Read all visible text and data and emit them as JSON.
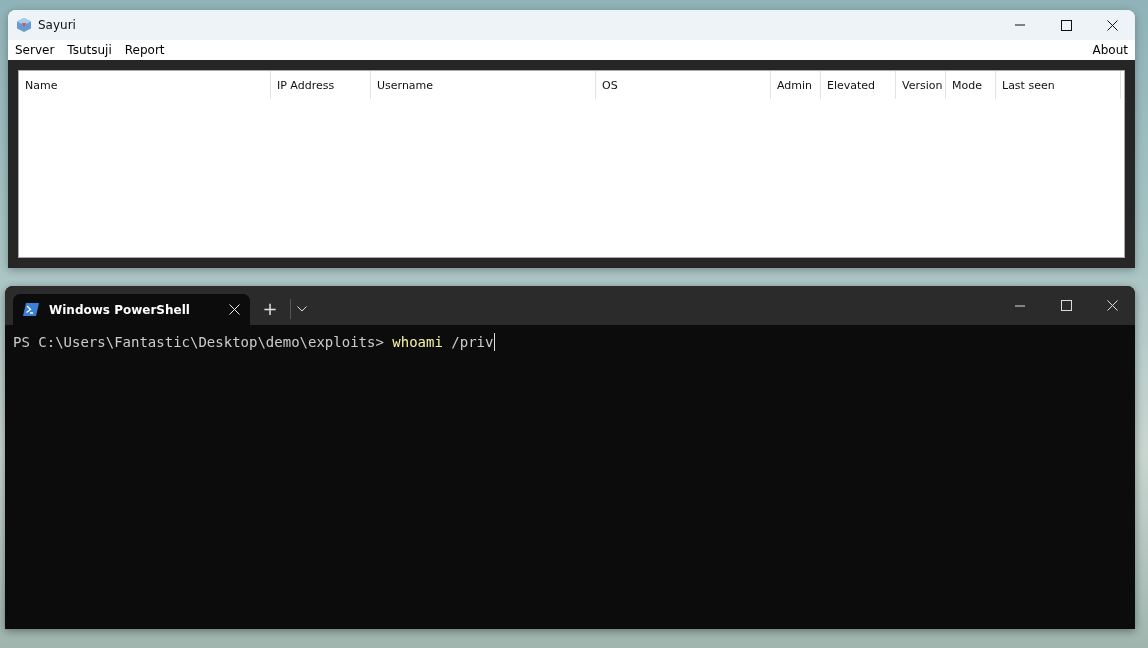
{
  "app_window": {
    "title": "Sayuri",
    "menu": [
      "Server",
      "Tsutsuji",
      "Report"
    ],
    "menu_right": "About",
    "table": {
      "columns": [
        "Name",
        "IP Address",
        "Username",
        "OS",
        "Admin",
        "Elevated",
        "Version",
        "Mode",
        "Last seen"
      ]
    }
  },
  "terminal_window": {
    "tabs": [
      {
        "label": "Windows PowerShell",
        "selected": true
      }
    ],
    "new_tab": "+",
    "lines": [
      {
        "prompt": "PS C:\\Users\\Fantastic\\Desktop\\demo\\exploits>",
        "command": "whoami",
        "argument": "/priv",
        "cursor": true
      }
    ]
  }
}
